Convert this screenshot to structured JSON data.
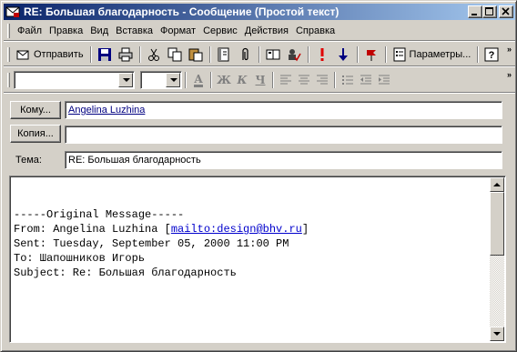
{
  "window": {
    "title": "RE: Большая благодарность - Сообщение (Простой текст)"
  },
  "menu": [
    {
      "label": "Файл"
    },
    {
      "label": "Правка"
    },
    {
      "label": "Вид"
    },
    {
      "label": "Вставка"
    },
    {
      "label": "Формат"
    },
    {
      "label": "Сервис"
    },
    {
      "label": "Действия"
    },
    {
      "label": "Справка"
    }
  ],
  "toolbar": {
    "send_label": "Отправить",
    "options_label": "Параметры...",
    "chevron": "»"
  },
  "format": {
    "font_value": "",
    "size_value": "",
    "bold": "Ж",
    "italic": "К",
    "underline": "Ч",
    "font_color": "A"
  },
  "header": {
    "to_button": "Кому...",
    "to_value": "Angelina Luzhina",
    "cc_button": "Копия...",
    "cc_value": "",
    "subject_label": "Тема:",
    "subject_value": "RE: Большая благодарность"
  },
  "body": {
    "line1": "-----Original Message-----",
    "from_prefix": "From: Angelina Luzhina [",
    "from_link": "mailto:design@bhv.ru",
    "from_suffix": "]",
    "sent": "Sent: Tuesday, September 05, 2000 11:00 PM",
    "to": "To: Шапошников Игорь",
    "subject": "Subject: Re: Большая благодарность"
  },
  "colors": {
    "title_start": "#0a246a",
    "title_end": "#a6caf0",
    "face": "#d4d0c8",
    "link": "#000080"
  }
}
